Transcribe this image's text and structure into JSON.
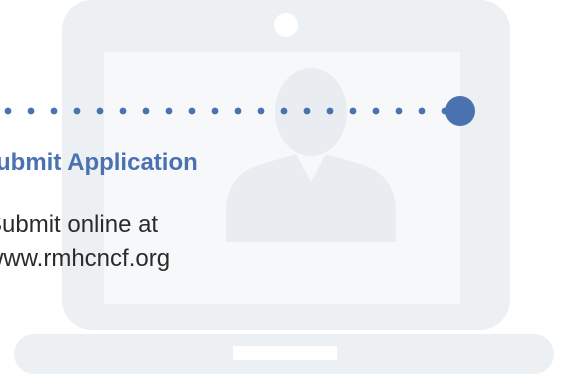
{
  "step": {
    "title": "Submit Application",
    "line1": "Submit online at",
    "line2": "www.rmhcncf.org"
  },
  "colors": {
    "accent": "#4a72b0",
    "laptop": "#edf0f3",
    "laptop_screen": "#f7f8fa",
    "figure": "#e9ecf0",
    "text": "#2b2b2b"
  },
  "icons": {
    "laptop": "laptop-icon",
    "person": "person-silhouette-icon",
    "timeline_node": "timeline-node-icon"
  }
}
